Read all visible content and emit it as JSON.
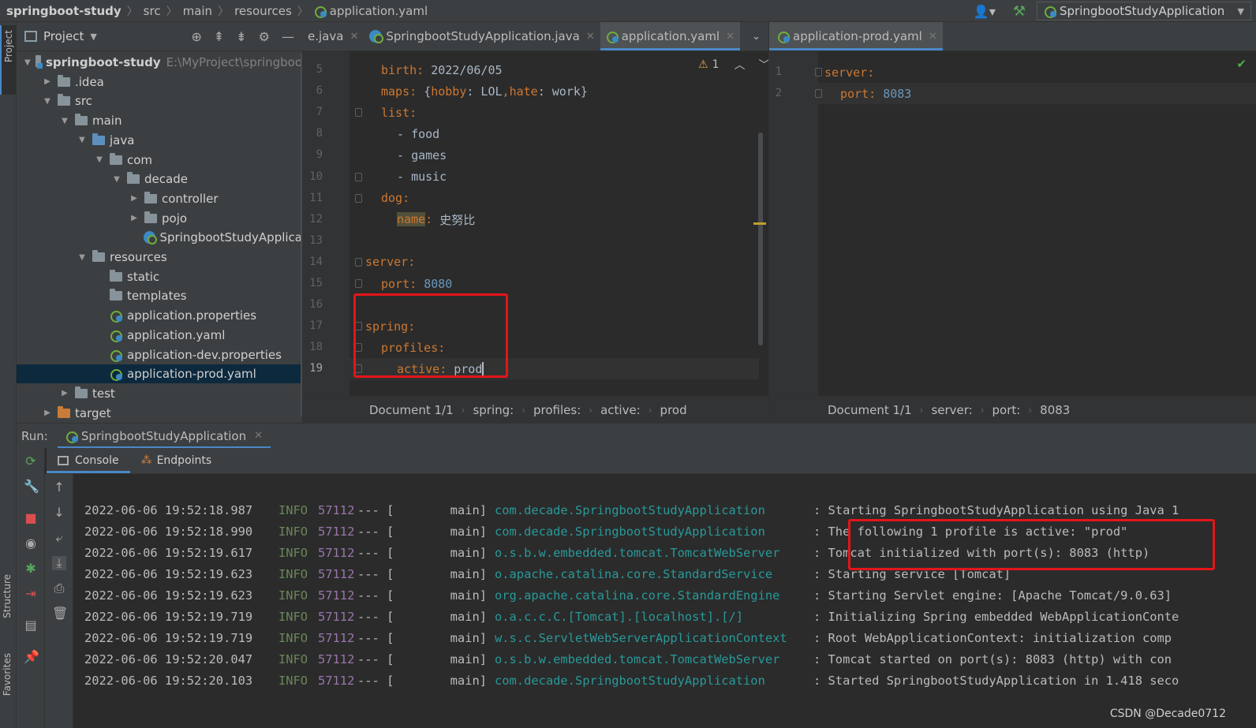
{
  "topbar": {
    "crumbs": [
      "springboot-study",
      "src",
      "main",
      "resources",
      "application.yaml"
    ],
    "run_config": "SpringbootStudyApplication"
  },
  "left_strip": {
    "project": "Project",
    "structure": "Structure",
    "favorites": "Favorites"
  },
  "project": {
    "header": "Project",
    "tree": [
      {
        "label": "springboot-study",
        "path": "E:\\MyProject\\springboo",
        "depth": 0,
        "arrow": "open",
        "icon": "module-folder"
      },
      {
        "label": ".idea",
        "depth": 1,
        "arrow": "closed",
        "icon": "folder"
      },
      {
        "label": "src",
        "depth": 1,
        "arrow": "open",
        "icon": "folder"
      },
      {
        "label": "main",
        "depth": 2,
        "arrow": "open",
        "icon": "folder"
      },
      {
        "label": "java",
        "depth": 3,
        "arrow": "open",
        "icon": "blue-folder"
      },
      {
        "label": "com",
        "depth": 4,
        "arrow": "open",
        "icon": "package"
      },
      {
        "label": "decade",
        "depth": 5,
        "arrow": "open",
        "icon": "package"
      },
      {
        "label": "controller",
        "depth": 6,
        "arrow": "closed",
        "icon": "package"
      },
      {
        "label": "pojo",
        "depth": 6,
        "arrow": "closed",
        "icon": "package"
      },
      {
        "label": "SpringbootStudyApplica",
        "depth": 6,
        "arrow": "none",
        "icon": "spring-class"
      },
      {
        "label": "resources",
        "depth": 3,
        "arrow": "open",
        "icon": "resources-folder"
      },
      {
        "label": "static",
        "depth": 4,
        "arrow": "none",
        "icon": "folder"
      },
      {
        "label": "templates",
        "depth": 4,
        "arrow": "none",
        "icon": "folder"
      },
      {
        "label": "application.properties",
        "depth": 4,
        "arrow": "none",
        "icon": "spring-config"
      },
      {
        "label": "application.yaml",
        "depth": 4,
        "arrow": "none",
        "icon": "spring-config"
      },
      {
        "label": "application-dev.properties",
        "depth": 4,
        "arrow": "none",
        "icon": "spring-config"
      },
      {
        "label": "application-prod.yaml",
        "depth": 4,
        "arrow": "none",
        "icon": "spring-config",
        "selected": true
      },
      {
        "label": "test",
        "depth": 2,
        "arrow": "closed",
        "icon": "folder"
      },
      {
        "label": "target",
        "depth": 1,
        "arrow": "closed",
        "icon": "orange-folder"
      }
    ]
  },
  "editor_left": {
    "tabs": [
      {
        "label": "e.java",
        "icon": "java-icon"
      },
      {
        "label": "SpringbootStudyApplication.java",
        "icon": "java-icon"
      },
      {
        "label": "application.yaml",
        "icon": "yaml-icon",
        "active": true
      }
    ],
    "warnings": "1",
    "lines": [
      {
        "n": "5",
        "key": "birth",
        "value": "2022/06/05",
        "indent": 1
      },
      {
        "n": "6",
        "key": "maps",
        "value": "{hobby: LOL,hate: work}",
        "indent": 1
      },
      {
        "n": "7",
        "key": "list",
        "value": "",
        "indent": 1
      },
      {
        "n": "8",
        "item": "food",
        "indent": 2
      },
      {
        "n": "9",
        "item": "games",
        "indent": 2
      },
      {
        "n": "10",
        "item": "music",
        "indent": 2
      },
      {
        "n": "11",
        "key": "dog",
        "value": "",
        "indent": 1
      },
      {
        "n": "12",
        "key": "name",
        "value": "史努比",
        "indent": 2,
        "highlight": true
      },
      {
        "n": "13",
        "indent": 0
      },
      {
        "n": "14",
        "key": "server",
        "value": "",
        "indent": 0
      },
      {
        "n": "15",
        "key": "port",
        "value": "8080",
        "indent": 1,
        "number": true
      },
      {
        "n": "16",
        "indent": 0
      },
      {
        "n": "17",
        "key": "spring",
        "value": "",
        "indent": 0
      },
      {
        "n": "18",
        "key": "profiles",
        "value": "",
        "indent": 1
      },
      {
        "n": "19",
        "key": "active",
        "value": "prod",
        "indent": 2,
        "current": true
      }
    ],
    "breadcrumb": [
      "Document 1/1",
      "spring:",
      "profiles:",
      "active:",
      "prod"
    ]
  },
  "editor_right": {
    "tab": "application-prod.yaml",
    "lines": [
      {
        "n": "1",
        "key": "server",
        "value": "",
        "indent": 0
      },
      {
        "n": "2",
        "key": "port",
        "value": "8083",
        "indent": 1,
        "number": true
      }
    ],
    "breadcrumb": [
      "Document 1/1",
      "server:",
      "port:",
      "8083"
    ]
  },
  "run": {
    "label": "Run:",
    "config": "SpringbootStudyApplication",
    "tabs": [
      "Console",
      "Endpoints"
    ]
  },
  "console": [
    {
      "ts": "2022-06-06 19:52:18.987",
      "level": "INFO",
      "pid": "57112",
      "thread": "main]",
      "logger": "com.decade.SpringbootStudyApplication",
      "msg": ": Starting SpringbootStudyApplication using Java 1"
    },
    {
      "ts": "2022-06-06 19:52:18.990",
      "level": "INFO",
      "pid": "57112",
      "thread": "main]",
      "logger": "com.decade.SpringbootStudyApplication",
      "msg": ": The following 1 profile is active: \"prod\""
    },
    {
      "ts": "2022-06-06 19:52:19.617",
      "level": "INFO",
      "pid": "57112",
      "thread": "main]",
      "logger": "o.s.b.w.embedded.tomcat.TomcatWebServer",
      "msg": ": Tomcat initialized with port(s): 8083 (http)"
    },
    {
      "ts": "2022-06-06 19:52:19.623",
      "level": "INFO",
      "pid": "57112",
      "thread": "main]",
      "logger": "o.apache.catalina.core.StandardService",
      "msg": ": Starting service [Tomcat]"
    },
    {
      "ts": "2022-06-06 19:52:19.623",
      "level": "INFO",
      "pid": "57112",
      "thread": "main]",
      "logger": "org.apache.catalina.core.StandardEngine",
      "msg": ": Starting Servlet engine: [Apache Tomcat/9.0.63]"
    },
    {
      "ts": "2022-06-06 19:52:19.719",
      "level": "INFO",
      "pid": "57112",
      "thread": "main]",
      "logger": "o.a.c.c.C.[Tomcat].[localhost].[/]",
      "msg": ": Initializing Spring embedded WebApplicationConte"
    },
    {
      "ts": "2022-06-06 19:52:19.719",
      "level": "INFO",
      "pid": "57112",
      "thread": "main]",
      "logger": "w.s.c.ServletWebServerApplicationContext",
      "msg": ": Root WebApplicationContext: initialization comp"
    },
    {
      "ts": "2022-06-06 19:52:20.047",
      "level": "INFO",
      "pid": "57112",
      "thread": "main]",
      "logger": "o.s.b.w.embedded.tomcat.TomcatWebServer",
      "msg": ": Tomcat started on port(s): 8083 (http) with con"
    },
    {
      "ts": "2022-06-06 19:52:20.103",
      "level": "INFO",
      "pid": "57112",
      "thread": "main]",
      "logger": "com.decade.SpringbootStudyApplication",
      "msg": ": Started SpringbootStudyApplication in 1.418 seco"
    }
  ],
  "watermark": "CSDN @Decade0712",
  "colors": {
    "keyword": "#cc7832",
    "number": "#6897bb",
    "logger": "#299999",
    "level": "#6a8759",
    "pid": "#9876aa",
    "highlight": "#e3151a"
  }
}
